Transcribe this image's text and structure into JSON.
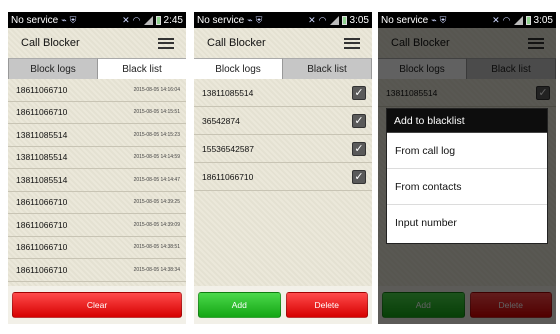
{
  "status_bar": {
    "carrier": "No service",
    "time_p1": "2:45",
    "time_p2": "3:05",
    "time_p3": "3:05"
  },
  "app": {
    "title": "Call Blocker"
  },
  "tabs": {
    "block_logs": "Block logs",
    "black_list": "Black list"
  },
  "block_logs": [
    {
      "number": "18611066710",
      "time": "2015-08-05 14:16:04"
    },
    {
      "number": "18611066710",
      "time": "2015-08-05 14:15:51"
    },
    {
      "number": "13811085514",
      "time": "2015-08-05 14:15:23"
    },
    {
      "number": "13811085514",
      "time": "2015-08-05 14:14:59"
    },
    {
      "number": "13811085514",
      "time": "2015-08-05 14:14:47"
    },
    {
      "number": "18611066710",
      "time": "2015-08-05 14:39:25"
    },
    {
      "number": "18611066710",
      "time": "2015-08-05 14:39:09"
    },
    {
      "number": "18611066710",
      "time": "2015-08-05 14:38:51"
    },
    {
      "number": "18611066710",
      "time": "2015-08-05 14:38:34"
    }
  ],
  "black_list": [
    {
      "number": "13811085514"
    },
    {
      "number": "36542874"
    },
    {
      "number": "15536542587"
    },
    {
      "number": "18611066710"
    }
  ],
  "buttons": {
    "clear": "Clear",
    "add": "Add",
    "delete": "Delete"
  },
  "dialog": {
    "title": "Add to blacklist",
    "options": [
      "From call log",
      "From contacts",
      "Input number"
    ]
  },
  "colors": {
    "red_button": "#e81818",
    "green_button": "#22b822",
    "status_bar": "#000000"
  }
}
